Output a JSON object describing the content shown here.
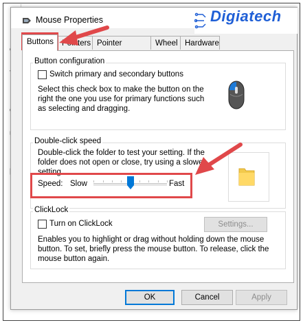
{
  "window": {
    "title": "Mouse Properties"
  },
  "branding": {
    "logo_text": "Digiatech",
    "color": "#1f5fd6"
  },
  "background": {
    "fragments": [
      "D",
      "ct",
      "ft",
      "ch",
      "ul",
      "ps",
      "I"
    ]
  },
  "tabs": [
    {
      "label": "Buttons",
      "active": true
    },
    {
      "label": "Pointers",
      "active": false
    },
    {
      "label": "Pointer Options",
      "active": false
    },
    {
      "label": "Wheel",
      "active": false
    },
    {
      "label": "Hardware",
      "active": false
    }
  ],
  "button_config": {
    "heading": "Button configuration",
    "checkbox_label": "Switch primary and secondary buttons",
    "checked": false,
    "desc_lines": [
      "Select this check box to make the button on the",
      "right the one you use for primary functions such",
      "as selecting and dragging."
    ]
  },
  "double_click": {
    "heading": "Double-click speed",
    "desc_lines": [
      "Double-click the folder to test your setting. If the",
      "folder does not open or close, try using a slower",
      "setting."
    ],
    "speed_label": "Speed:",
    "slow_label": "Slow",
    "fast_label": "Fast",
    "slider_value_fraction": 0.5
  },
  "clicklock": {
    "heading": "ClickLock",
    "checkbox_label": "Turn on ClickLock",
    "checked": false,
    "settings_button": "Settings...",
    "desc_lines": [
      "Enables you to highlight or drag without holding down the mouse",
      "button. To set, briefly press the mouse button. To release, click the",
      "mouse button again."
    ]
  },
  "footer": {
    "ok": "OK",
    "cancel": "Cancel",
    "apply": "Apply"
  },
  "annotations": {
    "highlight_color": "#e0484a"
  }
}
